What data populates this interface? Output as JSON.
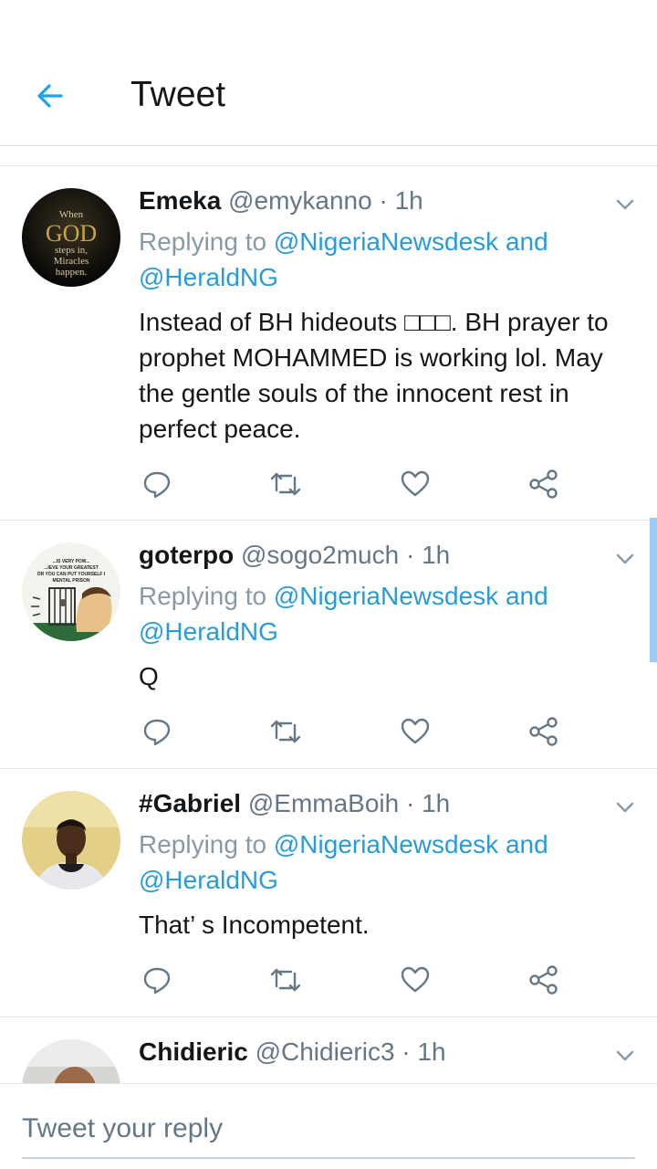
{
  "header": {
    "title": "Tweet",
    "back_icon": "arrow-left-icon",
    "accent": "#1da1f2"
  },
  "tweets": [
    {
      "name": "Emeka",
      "handle": "@emykanno",
      "dot": "·",
      "time": "1h",
      "reply_prefix": "Replying to",
      "mention1": "@NigeriaNewsdesk",
      "and": "and",
      "mention2": "@HeraldNG",
      "text": "Instead of BH hideouts □□□. BH prayer to prophet MOHAMMED is working lol. May the gentle souls of the innocent rest in perfect peace.",
      "avatar_text": [
        "When",
        "GOD",
        "steps in,",
        "Miracles",
        "happen."
      ]
    },
    {
      "name": "goterpo",
      "handle": "@sogo2much",
      "dot": "·",
      "time": "1h",
      "reply_prefix": "Replying to",
      "mention1": "@NigeriaNewsdesk",
      "and": "and",
      "mention2": "@HeraldNG",
      "text": "Q",
      "avatar_text": [
        "...IS VERY POW...",
        "...IEVE YOUR GREATEST",
        "OR YOU CAN PUT YOURSELF I",
        "MENTAL PRISON"
      ]
    },
    {
      "name": "#Gabriel",
      "handle": "@EmmaBoih",
      "dot": "·",
      "time": "1h",
      "reply_prefix": "Replying to",
      "mention1": "@NigeriaNewsdesk",
      "and": "and",
      "mention2": "@HeraldNG",
      "text": "That’ s Incompetent."
    },
    {
      "name": "Chidieric",
      "handle": "@Chidieric3",
      "dot": "·",
      "time": "1h"
    }
  ],
  "action_icons": [
    "reply-icon",
    "retweet-icon",
    "like-icon",
    "share-icon"
  ],
  "composer": {
    "placeholder": "Tweet your reply"
  }
}
